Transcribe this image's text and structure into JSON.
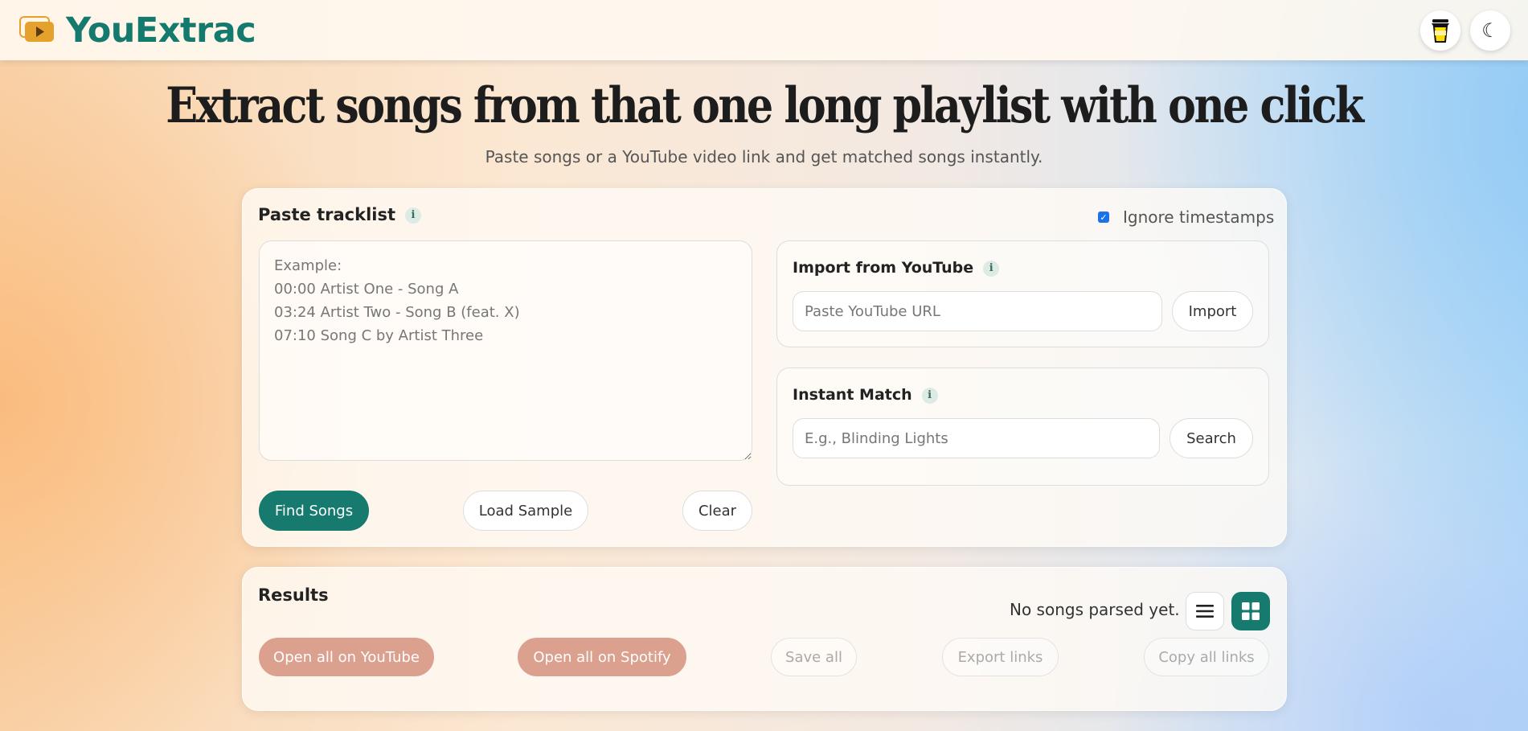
{
  "brand": {
    "name": "YouExtrac"
  },
  "header": {
    "coffee_icon": "coffee-cup-icon",
    "theme_icon": "☾"
  },
  "hero": {
    "title": "Extract songs from that one long playlist with one click",
    "subtitle": "Paste songs or a YouTube video link and get matched songs instantly."
  },
  "tracklist": {
    "title": "Paste tracklist",
    "info": "i",
    "ignore_timestamps_label": "Ignore timestamps",
    "ignore_timestamps_checked": true,
    "placeholder": "Example:\n00:00 Artist One - Song A\n03:24 Artist Two - Song B (feat. X)\n07:10 Song C by Artist Three",
    "find_label": "Find Songs",
    "sample_label": "Load Sample",
    "clear_label": "Clear"
  },
  "youtube": {
    "title": "Import from YouTube",
    "info": "i",
    "placeholder": "Paste YouTube URL",
    "button": "Import"
  },
  "instant": {
    "title": "Instant Match",
    "info": "i",
    "placeholder": "E.g., Blinding Lights",
    "button": "Search"
  },
  "results": {
    "title": "Results",
    "status": "No songs parsed yet.",
    "open_youtube": "Open all on YouTube",
    "open_spotify": "Open all on Spotify",
    "save_all": "Save all",
    "export_links": "Export links",
    "copy_all": "Copy all links",
    "active_view": "grid"
  },
  "colors": {
    "accent": "#177a6e",
    "brand_text": "#157a6e",
    "rose_button": "#dba08e",
    "logo": "#e6a02c"
  }
}
